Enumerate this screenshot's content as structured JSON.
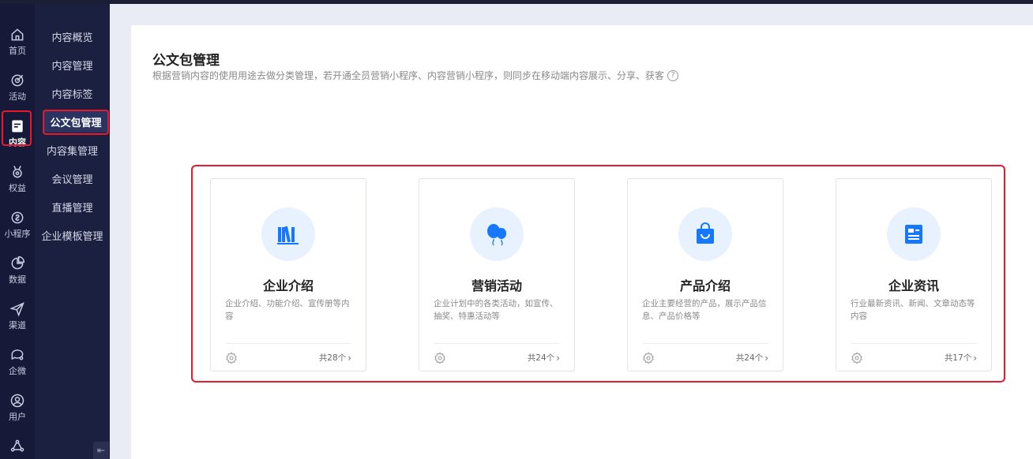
{
  "rail": {
    "items": [
      {
        "label": "首页",
        "icon": "home-icon"
      },
      {
        "label": "活动",
        "icon": "target-icon"
      },
      {
        "label": "内容",
        "icon": "document-icon"
      },
      {
        "label": "权益",
        "icon": "medal-icon"
      },
      {
        "label": "小程序",
        "icon": "link-icon"
      },
      {
        "label": "数据",
        "icon": "pie-chart-icon"
      },
      {
        "label": "渠道",
        "icon": "send-icon"
      },
      {
        "label": "企微",
        "icon": "chat-icon"
      },
      {
        "label": "用户",
        "icon": "user-icon"
      },
      {
        "label": "",
        "icon": "share-icon"
      }
    ],
    "active": "内容"
  },
  "submenu": {
    "items": [
      "内容概览",
      "内容管理",
      "内容标签",
      "公文包管理",
      "内容集管理",
      "会议管理",
      "直播管理",
      "企业模板管理"
    ],
    "active": "公文包管理"
  },
  "page": {
    "title": "公文包管理",
    "description": "根据营销内容的使用用途去做分类管理，若开通全员营销小程序、内容营销小程序，则同步在移动端内容展示、分享、获客"
  },
  "cards": [
    {
      "title": "企业介绍",
      "desc": "企业介绍、功能介绍、宣传册等内容",
      "count": "共28个",
      "icon": "books-icon"
    },
    {
      "title": "营销活动",
      "desc": "企业计划中的各类活动，如宣传、抽奖、特惠活动等",
      "count": "共24个",
      "icon": "balloons-icon"
    },
    {
      "title": "产品介绍",
      "desc": "企业主要经营的产品，展示产品信息、产品价格等",
      "count": "共24个",
      "icon": "shopping-bag-icon"
    },
    {
      "title": "企业资讯",
      "desc": "行业最新资讯、新闻、文章动态等内容",
      "count": "共17个",
      "icon": "news-icon"
    }
  ],
  "colors": {
    "accent": "#1677ff",
    "highlight": "#e8192c",
    "rail_bg": "#161a38",
    "submenu_bg": "#1b2040"
  }
}
